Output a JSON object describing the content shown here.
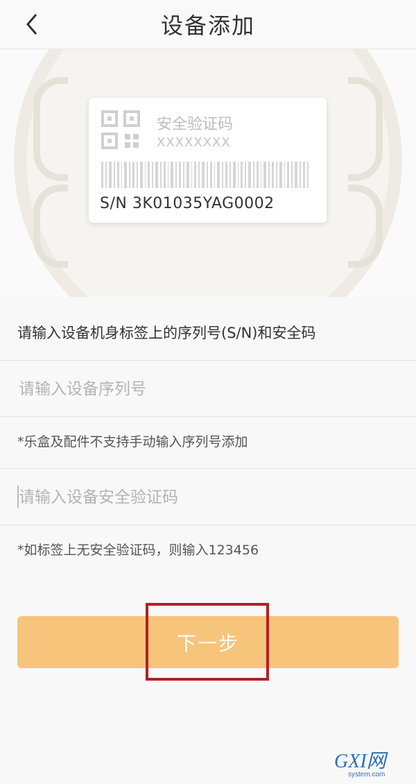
{
  "header": {
    "title": "设备添加",
    "back_icon": "chevron-left-icon"
  },
  "label_card": {
    "title": "安全验证码",
    "code": "XXXXXXXX",
    "sn": "S/N  3K01035YAG0002",
    "qr_icon": "qr-code-icon",
    "barcode_icon": "barcode-icon"
  },
  "form": {
    "instruction": "请输入设备机身标签上的序列号(S/N)和安全码",
    "serial_placeholder": "请输入设备序列号",
    "serial_value": "",
    "serial_note": "*乐盒及配件不支持手动输入序列号添加",
    "code_placeholder": "请输入设备安全验证码",
    "code_value": "",
    "code_note": "*如标签上无安全验证码，则输入123456"
  },
  "actions": {
    "next_label": "下一步"
  },
  "watermark": {
    "brand": "GXI网",
    "domain": "system.com"
  },
  "colors": {
    "button": "#f6c47b",
    "highlight": "#b32020",
    "background": "#f8f8f8"
  }
}
